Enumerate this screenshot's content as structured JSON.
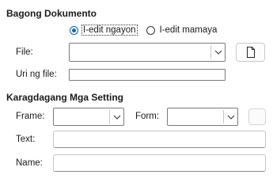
{
  "new_document": {
    "title": "Bagong Dokumento",
    "radio_edit_now": "I-edit ngayon",
    "radio_edit_later": "I-edit mamaya",
    "file_label": "File:",
    "file_value": "",
    "file_type_label": "Uri ng file:",
    "file_type_value": ""
  },
  "additional_settings": {
    "title": "Karagdagang Mga Setting",
    "frame_label": "Frame:",
    "frame_value": "",
    "form_label": "Form:",
    "form_value": "",
    "text_label": "Text:",
    "text_value": "",
    "name_label": "Name:",
    "name_value": ""
  },
  "icons": {
    "file_button": "document-icon",
    "dropdown": "chevron-down-icon"
  },
  "colors": {
    "accent": "#0067c0"
  }
}
